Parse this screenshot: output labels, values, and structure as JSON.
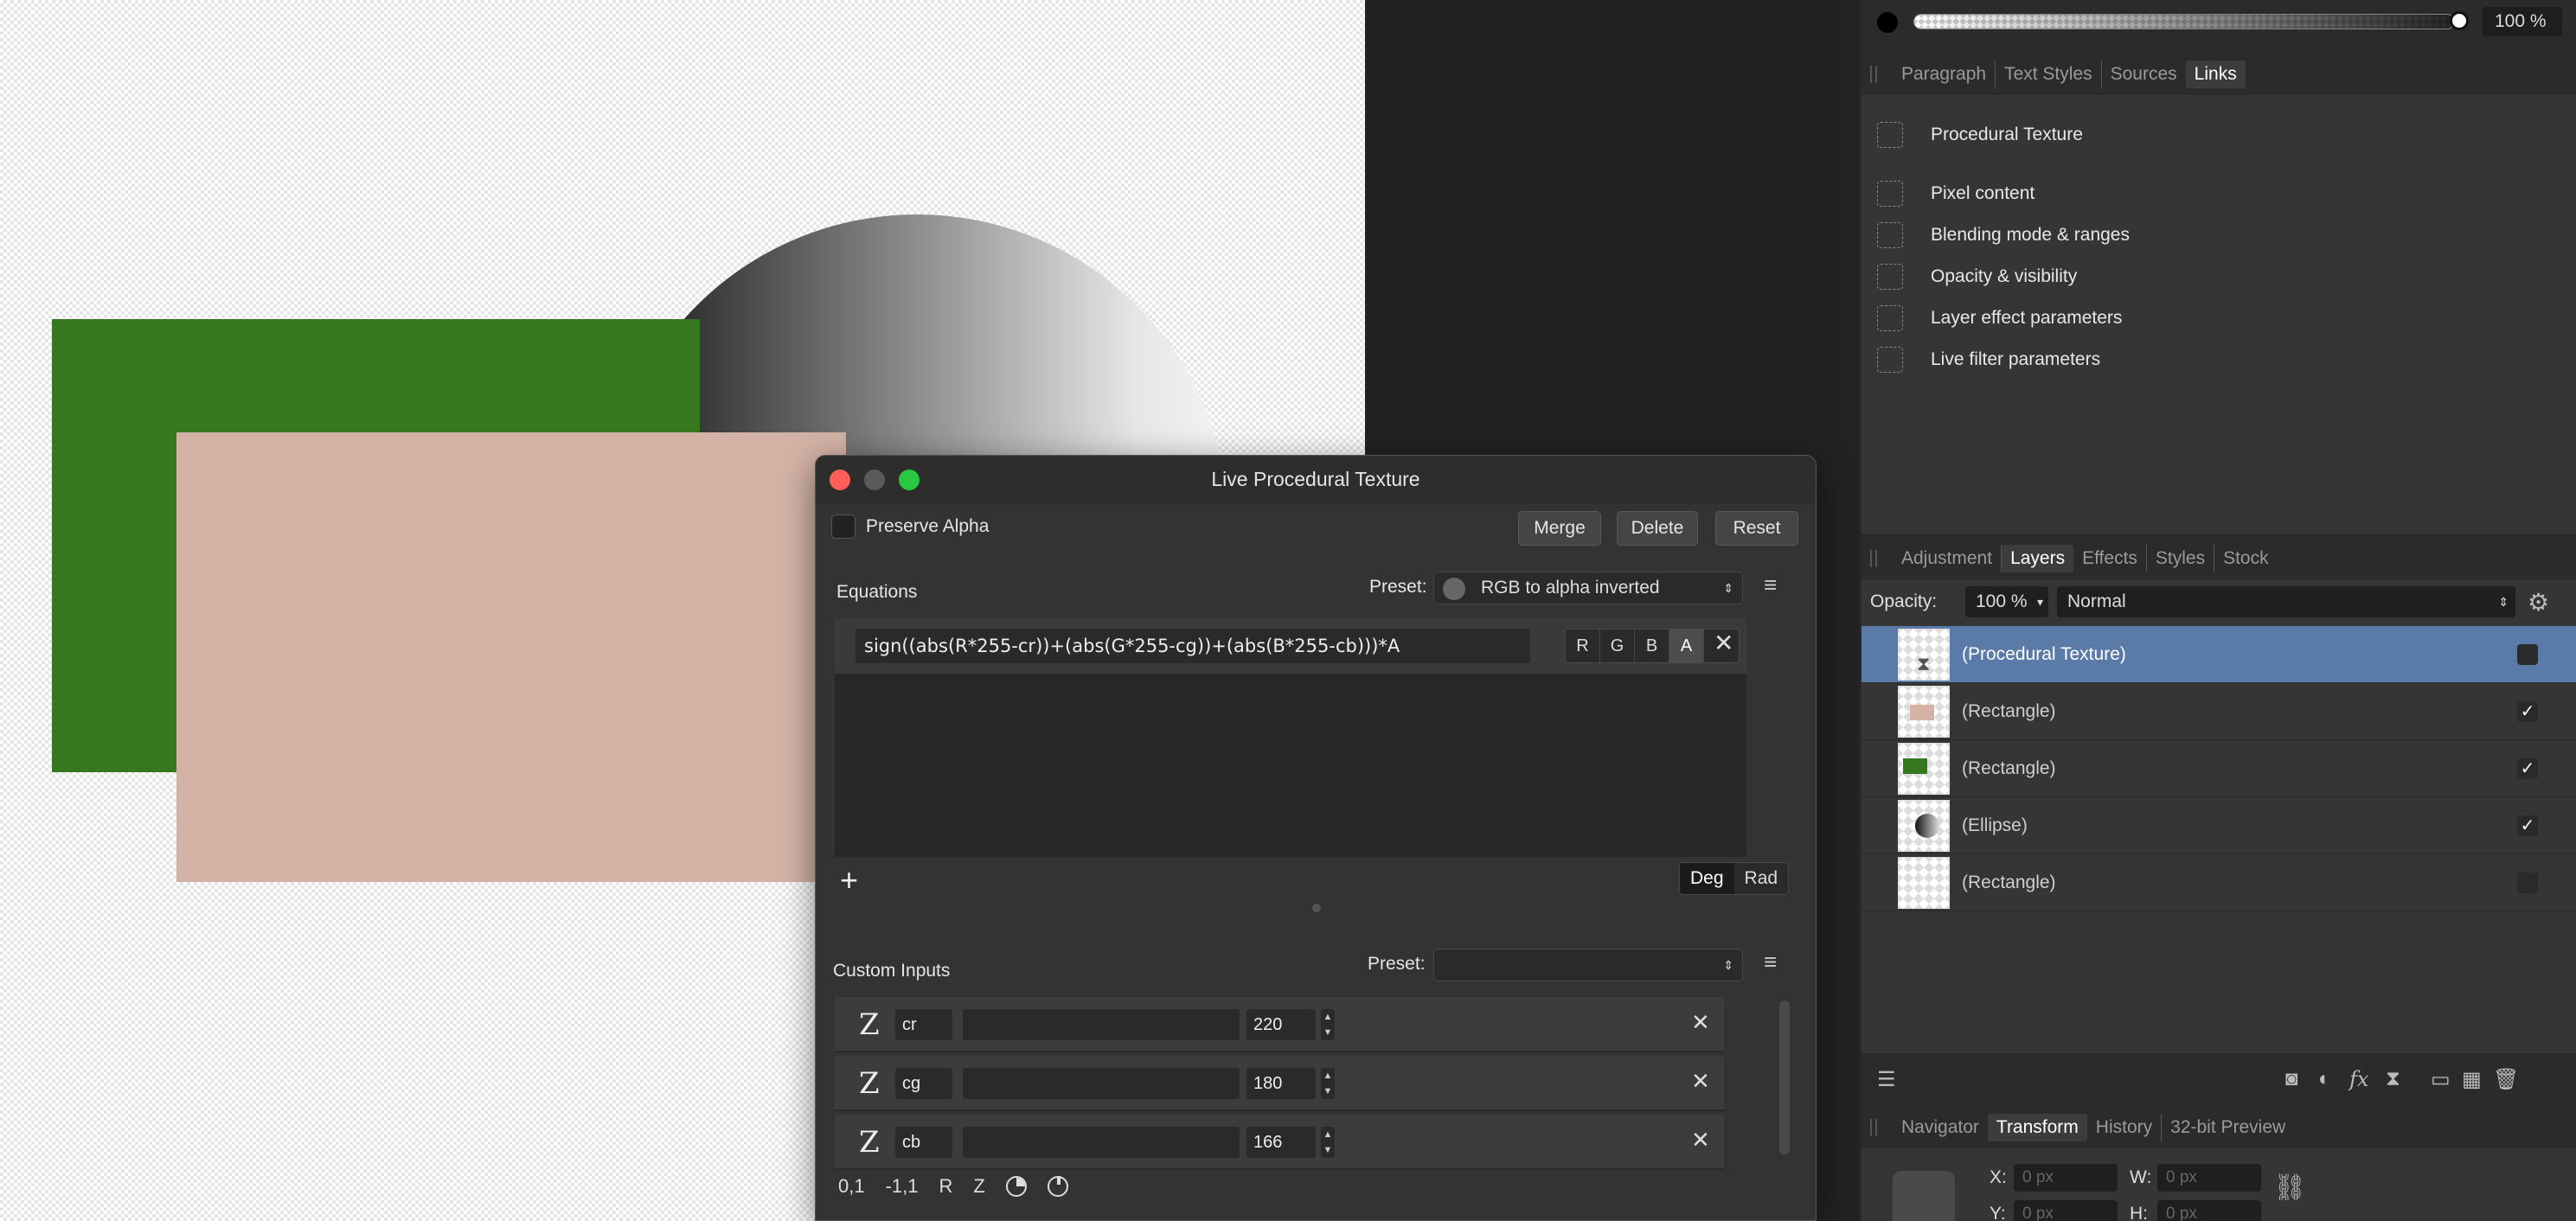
{
  "colors": {
    "accent": "#5a7aa8",
    "shape_green": "#367820",
    "shape_pink": "#d4b3a6",
    "traffic_close": "#ff5f57",
    "traffic_max": "#28c840",
    "traffic_disabled": "#5a5a5a"
  },
  "color_panel": {
    "opacity": "100 %"
  },
  "links_panel": {
    "tabs": [
      "Paragraph",
      "Text Styles",
      "Sources",
      "Links"
    ],
    "active_tab": "Links",
    "items": [
      "Procedural Texture",
      "Pixel content",
      "Blending mode & ranges",
      "Opacity & visibility",
      "Layer effect parameters",
      "Live filter parameters"
    ]
  },
  "layers_panel": {
    "tabs": [
      "Adjustment",
      "Layers",
      "Effects",
      "Styles",
      "Stock"
    ],
    "active_tab": "Layers",
    "opacity_label": "Opacity:",
    "opacity_value": "100 %",
    "blend_mode": "Normal",
    "layers": [
      {
        "name": "(Procedural Texture)",
        "visible": false,
        "selected": true
      },
      {
        "name": "(Rectangle)",
        "visible": true,
        "selected": false
      },
      {
        "name": "(Rectangle)",
        "visible": true,
        "selected": false
      },
      {
        "name": "(Ellipse)",
        "visible": true,
        "selected": false
      },
      {
        "name": "(Rectangle)",
        "visible": false,
        "selected": false
      }
    ],
    "footer_icons": [
      "layers-stack-icon",
      "mask-icon",
      "adjustment-icon",
      "fx-icon",
      "live-filter-icon",
      "folder-icon",
      "pixel-layer-icon",
      "trash-icon"
    ]
  },
  "transform_panel": {
    "tabs": [
      "Navigator",
      "Transform",
      "History",
      "32-bit Preview"
    ],
    "active_tab": "Transform",
    "x_label": "X:",
    "x_value": "0 px",
    "y_label": "Y:",
    "y_value": "0 px",
    "w_label": "W:",
    "w_value": "0 px",
    "h_label": "H:",
    "h_value": "0 px"
  },
  "dialog": {
    "title": "Live Procedural Texture",
    "preserve_alpha_label": "Preserve Alpha",
    "merge_label": "Merge",
    "delete_label": "Delete",
    "reset_label": "Reset",
    "equations_label": "Equations",
    "preset_label": "Preset:",
    "equations_preset": "RGB to alpha inverted",
    "equation": "sign((abs(R*255-cr))+(abs(G*255-cg))+(abs(B*255-cb)))*A",
    "channels": [
      "R",
      "G",
      "B",
      "A"
    ],
    "active_channel": "A",
    "add_symbol": "+",
    "angle_modes": [
      "Deg",
      "Rad"
    ],
    "active_angle_mode": "Deg",
    "custom_inputs_label": "Custom Inputs",
    "custom_preset_label": "Preset:",
    "custom_preset_value": "",
    "inputs": [
      {
        "type": "Z",
        "name": "cr",
        "value": "220"
      },
      {
        "type": "Z",
        "name": "cg",
        "value": "180"
      },
      {
        "type": "Z",
        "name": "cb",
        "value": "166"
      }
    ],
    "bottom_tools": [
      "0,1",
      "-1,1",
      "R",
      "Z"
    ]
  }
}
